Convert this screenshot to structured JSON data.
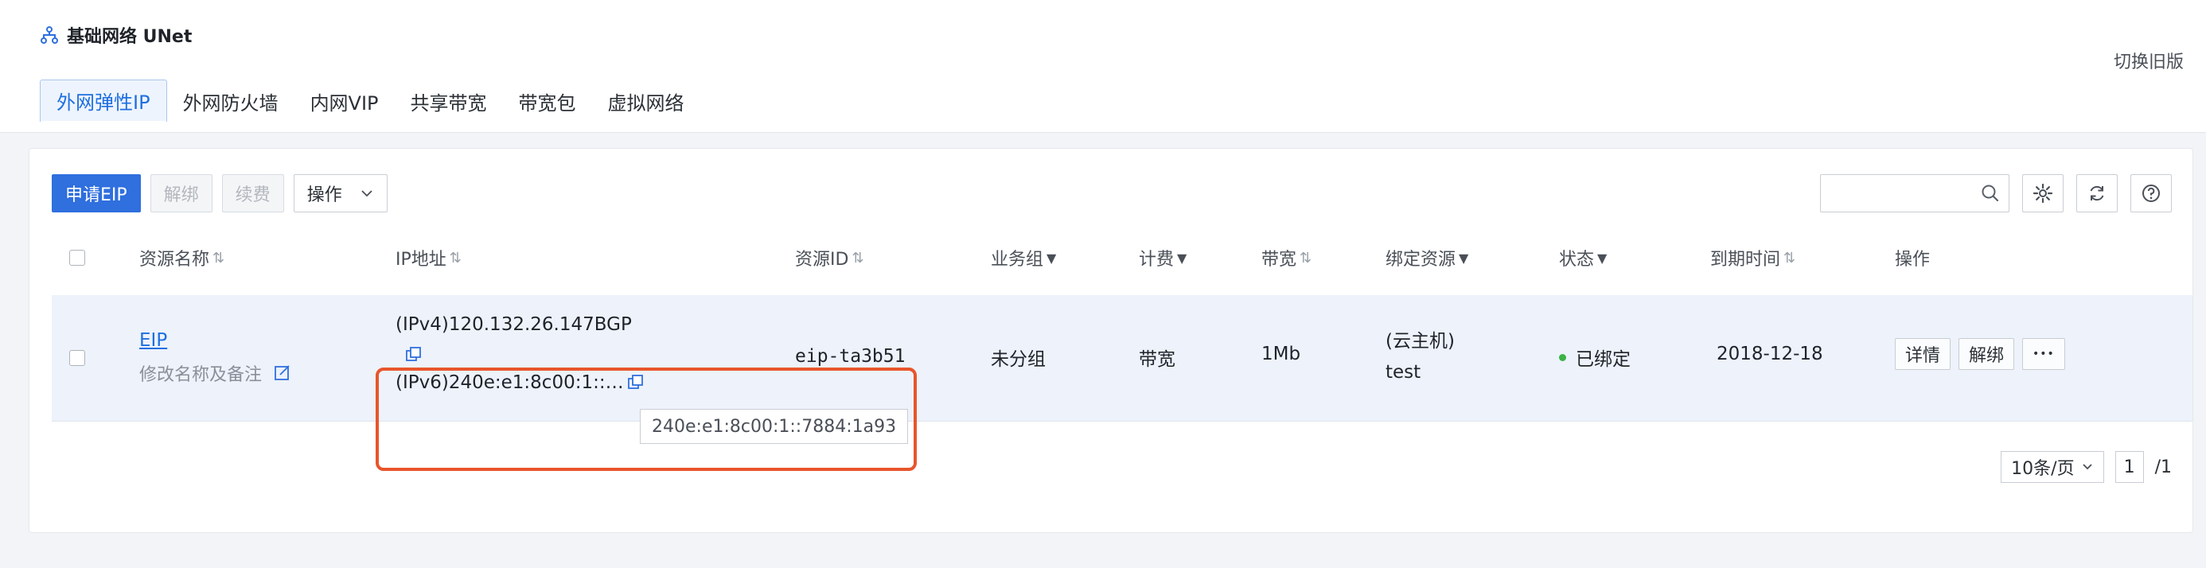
{
  "header": {
    "title": "基础网络 UNet",
    "title_icon": "network-icon",
    "switch_old": "切换旧版",
    "tabs": [
      {
        "label": "外网弹性IP",
        "active": true
      },
      {
        "label": "外网防火墙",
        "active": false
      },
      {
        "label": "内网VIP",
        "active": false
      },
      {
        "label": "共享带宽",
        "active": false
      },
      {
        "label": "带宽包",
        "active": false
      },
      {
        "label": "虚拟网络",
        "active": false
      }
    ]
  },
  "toolbar": {
    "apply_eip": "申请EIP",
    "unbind": "解绑",
    "renew": "续费",
    "operations": "操作",
    "search_placeholder": ""
  },
  "table": {
    "columns": {
      "name": "资源名称",
      "ip": "IP地址",
      "resource_id": "资源ID",
      "business_group": "业务组",
      "billing": "计费",
      "bandwidth": "带宽",
      "bound_resource": "绑定资源",
      "status": "状态",
      "expire": "到期时间",
      "actions": "操作"
    },
    "rows": [
      {
        "name": "EIP",
        "note_action": "修改名称及备注",
        "ipv4": "(IPv4)120.132.26.147BGP",
        "ipv6": "(IPv6)240e:e1:8c00:1::…",
        "resource_id": "eip-ta3b51",
        "business_group": "未分组",
        "billing": "带宽",
        "bandwidth": "1Mb",
        "bound_type": "(云主机)",
        "bound_name": "test",
        "status": "已绑定",
        "expire": "2018-12-18",
        "actions": [
          "详情",
          "解绑",
          "•••"
        ]
      }
    ]
  },
  "tooltip": {
    "text": "240e:e1:8c00:1::7884:1a93"
  },
  "pagination": {
    "page_size": "10条/页",
    "current_page": "1",
    "total_pages": "/1"
  },
  "colors": {
    "accent": "#2f6fde",
    "highlight": "#e8552c",
    "status_bound": "#3bb346"
  }
}
